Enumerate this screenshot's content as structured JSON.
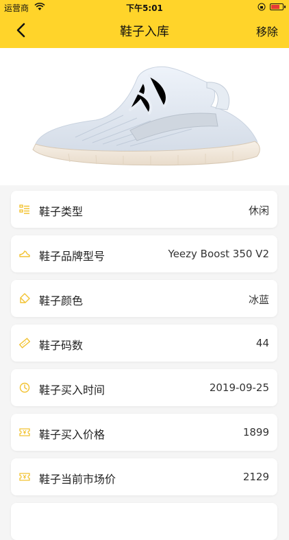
{
  "status_bar": {
    "carrier": "运营商",
    "time": "下午5:01",
    "battery_color": "#e53935"
  },
  "nav": {
    "title": "鞋子入库",
    "back_icon": "chevron-left-icon",
    "remove_label": "移除",
    "background": "#FFD42A"
  },
  "hero": {
    "image": "sneaker-photo"
  },
  "fields": [
    {
      "icon": "list-icon",
      "label": "鞋子类型",
      "value": "休闲"
    },
    {
      "icon": "shoe-icon",
      "label": "鞋子品牌型号",
      "value": "Yeezy Boost 350 V2"
    },
    {
      "icon": "tag-icon",
      "label": "鞋子颜色",
      "value": "冰蓝"
    },
    {
      "icon": "ruler-icon",
      "label": "鞋子码数",
      "value": "44"
    },
    {
      "icon": "clock-icon",
      "label": "鞋子买入时间",
      "value": "2019-09-25"
    },
    {
      "icon": "yen-ticket-icon",
      "label": "鞋子买入价格",
      "value": "1899"
    },
    {
      "icon": "yen-ticket-icon",
      "label": "鞋子当前市场价",
      "value": "2129"
    }
  ],
  "accent_color": "#F2C230"
}
